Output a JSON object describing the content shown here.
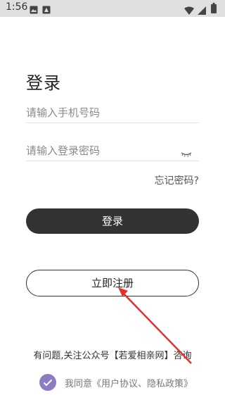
{
  "status_bar": {
    "time": "1:56"
  },
  "login": {
    "title": "登录",
    "phone_placeholder": "请输入手机号码",
    "password_placeholder": "请输入登录密码",
    "forgot_label": "忘记密码?",
    "login_button": "登录",
    "register_button": "立即注册",
    "hint": "有问题,关注公众号【若爱相亲网】咨询",
    "agreement": "我同意《用户协议、隐私政策》"
  },
  "colors": {
    "primary_button": "#333333",
    "checkbox": "#8e7cc3",
    "annotation_arrow": "#e0312f"
  },
  "icons": [
    "image-icon",
    "notification-icon",
    "wifi-icon",
    "signal-icon",
    "battery-icon",
    "eye-closed-icon",
    "check-icon"
  ]
}
